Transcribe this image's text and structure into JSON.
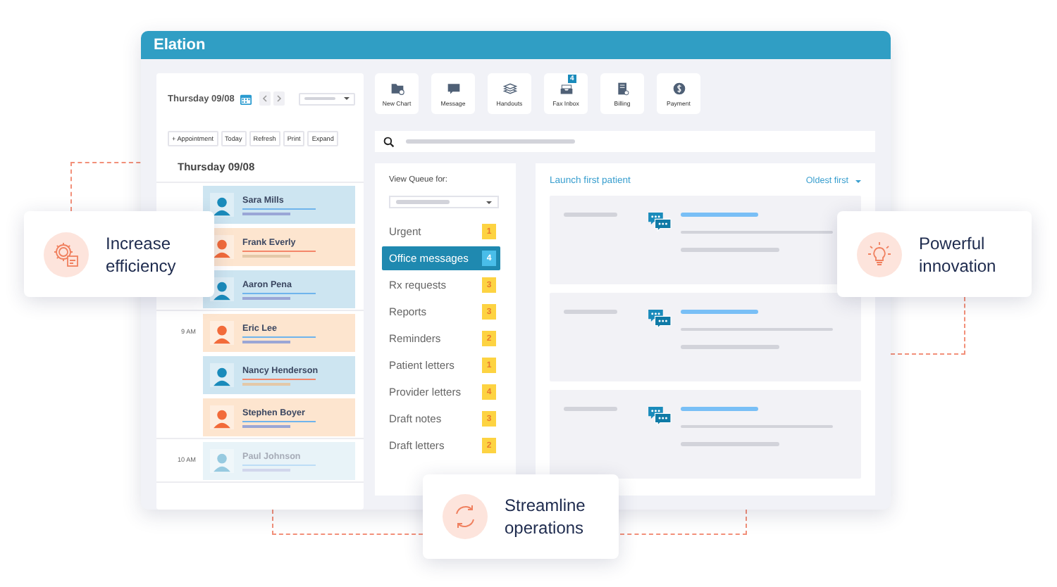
{
  "header": {
    "logo": "Elation"
  },
  "schedule": {
    "date": "Thursday 09/08",
    "buttons": [
      "+ Appointment",
      "Today",
      "Refresh",
      "Print",
      "Expand"
    ],
    "heading": "Thursday 09/08",
    "slots": [
      {
        "appointments": [
          {
            "name": "Sara Mills",
            "color": "#cde5f1",
            "faded": false
          },
          {
            "name": "Frank Everly",
            "color": "#fde5cf",
            "faded": false
          },
          {
            "name": "Aaron Pena",
            "color": "#cde5f1",
            "faded": false
          }
        ]
      },
      {
        "time": "9 AM",
        "appointments": [
          {
            "name": "Eric Lee",
            "color": "#fde5cf",
            "faded": false
          },
          {
            "name": "Nancy Henderson",
            "color": "#cde5f1",
            "faded": false
          },
          {
            "name": "Stephen Boyer",
            "color": "#fde5cf",
            "faded": false
          }
        ]
      },
      {
        "time": "10 AM",
        "appointments": [
          {
            "name": "Paul Johnson",
            "color": "#cde5f1",
            "faded": true
          }
        ]
      }
    ]
  },
  "toolbar": [
    {
      "label": "New Chart",
      "kind": "folder"
    },
    {
      "label": "Message",
      "kind": "message"
    },
    {
      "label": "Handouts",
      "kind": "stack"
    },
    {
      "label": "Fax Inbox",
      "kind": "tray",
      "badge": "4"
    },
    {
      "label": "Billing",
      "kind": "document"
    },
    {
      "label": "Payment",
      "kind": "coin"
    }
  ],
  "queue": {
    "label": "View Queue for:",
    "items": [
      {
        "label": "Urgent",
        "count": "1",
        "selected": false
      },
      {
        "label": "Office messages",
        "count": "4",
        "selected": true
      },
      {
        "label": "Rx requests",
        "count": "3",
        "selected": false
      },
      {
        "label": "Reports",
        "count": "3",
        "selected": false
      },
      {
        "label": "Reminders",
        "count": "2",
        "selected": false
      },
      {
        "label": "Patient letters",
        "count": "1",
        "selected": false
      },
      {
        "label": "Provider letters",
        "count": "4",
        "selected": false
      },
      {
        "label": "Draft notes",
        "count": "3",
        "selected": false
      },
      {
        "label": "Draft letters",
        "count": "2",
        "selected": false
      }
    ]
  },
  "messages": {
    "link": "Launch first patient",
    "sort": "Oldest first"
  },
  "features": [
    {
      "title": "Increase efficiency",
      "kind": "gear"
    },
    {
      "title": "Powerful innovation",
      "kind": "bulb"
    },
    {
      "title": "Streamline operations",
      "kind": "cycle"
    }
  ]
}
